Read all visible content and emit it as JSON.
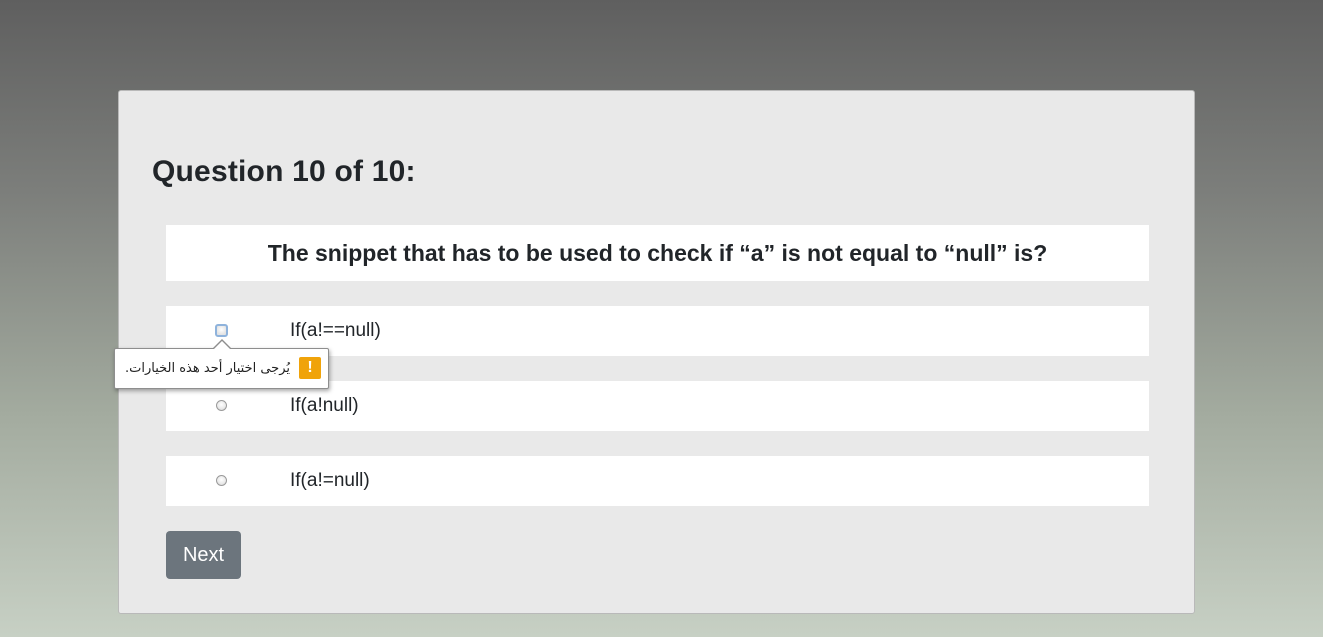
{
  "quiz": {
    "title": "Question 10 of 10:",
    "question": "The snippet that has to be used to check if “a” is not equal to “null” is?",
    "options": [
      {
        "label": "If(a!==null)"
      },
      {
        "label": "If(a!null)"
      },
      {
        "label": "If(a!=null)"
      }
    ],
    "next_label": "Next"
  },
  "validation": {
    "message": "يُرجى اختيار أحد هذه الخيارات.",
    "icon": "warning-icon",
    "icon_glyph": "!",
    "icon_color": "#f0a30a"
  },
  "colors": {
    "button": "#6c757d",
    "card": "#e9e9e9"
  }
}
